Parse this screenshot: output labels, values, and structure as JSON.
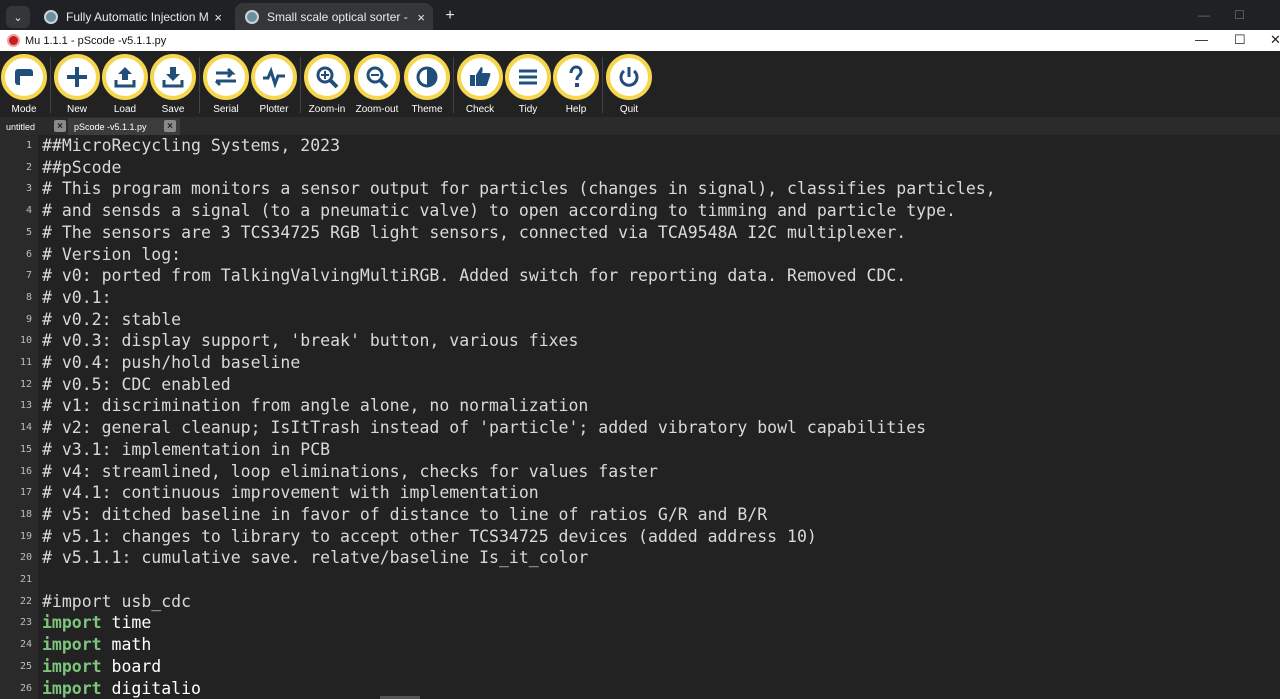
{
  "browser": {
    "tabs": [
      {
        "title": "Fully Automatic Injection Machi",
        "active": false
      },
      {
        "title": "Small scale optical sorter - Rese",
        "active": true
      }
    ],
    "new_tab": "+",
    "close": "×",
    "menu": "⌄"
  },
  "window": {
    "title": "Mu 1.1.1 - pScode -v5.1.1.py",
    "minimize": "—",
    "maximize": "☐",
    "close": "✕"
  },
  "toolbar": {
    "accent": "#f5d64d",
    "buttons": [
      {
        "label": "Mode",
        "icon": "mode-icon"
      },
      {
        "label": "New",
        "icon": "plus-icon"
      },
      {
        "label": "Load",
        "icon": "upload-icon"
      },
      {
        "label": "Save",
        "icon": "download-icon"
      },
      {
        "label": "Serial",
        "icon": "arrows-icon"
      },
      {
        "label": "Plotter",
        "icon": "pulse-icon"
      },
      {
        "label": "Zoom-in",
        "icon": "zoom-in-icon"
      },
      {
        "label": "Zoom-out",
        "icon": "zoom-out-icon"
      },
      {
        "label": "Theme",
        "icon": "contrast-icon"
      },
      {
        "label": "Check",
        "icon": "thumbs-up-icon"
      },
      {
        "label": "Tidy",
        "icon": "lines-icon"
      },
      {
        "label": "Help",
        "icon": "question-icon"
      },
      {
        "label": "Quit",
        "icon": "power-icon"
      }
    ]
  },
  "editor_tabs": [
    {
      "label": "untitled",
      "active": false
    },
    {
      "label": "pScode -v5.1.1.py",
      "active": true
    }
  ],
  "code": {
    "lines": [
      {
        "n": "1",
        "text": "##MicroRecycling Systems, 2023"
      },
      {
        "n": "2",
        "text": "##pScode"
      },
      {
        "n": "3",
        "text": "# This program monitors a sensor output for particles (changes in signal), classifies particles,"
      },
      {
        "n": "4",
        "text": "# and sensds a signal (to a pneumatic valve) to open according to timming and particle type."
      },
      {
        "n": "5",
        "text": "# The sensors are 3 TCS34725 RGB light sensors, connected via TCA9548A I2C multiplexer."
      },
      {
        "n": "6",
        "text": "# Version log:"
      },
      {
        "n": "7",
        "text": "# v0: ported from TalkingValvingMultiRGB. Added switch for reporting data. Removed CDC."
      },
      {
        "n": "8",
        "text": "# v0.1:"
      },
      {
        "n": "9",
        "text": "# v0.2: stable"
      },
      {
        "n": "10",
        "text": "# v0.3: display support, 'break' button, various fixes"
      },
      {
        "n": "11",
        "text": "# v0.4: push/hold baseline"
      },
      {
        "n": "12",
        "text": "# v0.5: CDC enabled"
      },
      {
        "n": "13",
        "text": "# v1: discrimination from angle alone, no normalization"
      },
      {
        "n": "14",
        "text": "# v2: general cleanup; IsItTrash instead of 'particle'; added vibratory bowl capabilities"
      },
      {
        "n": "15",
        "text": "# v3.1: implementation in PCB"
      },
      {
        "n": "16",
        "text": "# v4: streamlined, loop eliminations, checks for values faster"
      },
      {
        "n": "17",
        "text": "# v4.1: continuous improvement with implementation"
      },
      {
        "n": "18",
        "text": "# v5: ditched baseline in favor of distance to line of ratios G/R and B/R"
      },
      {
        "n": "19",
        "text": "# v5.1: changes to library to accept other TCS34725 devices (added address 10)"
      },
      {
        "n": "20",
        "text": "# v5.1.1: cumulative save. relatve/baseline Is_it_color"
      },
      {
        "n": "21",
        "text": ""
      },
      {
        "n": "22",
        "text": "#import usb_cdc"
      }
    ],
    "imports": [
      {
        "n": "23",
        "kw": "import",
        "mod": " time"
      },
      {
        "n": "24",
        "kw": "import",
        "mod": " math"
      },
      {
        "n": "25",
        "kw": "import",
        "mod": " board"
      },
      {
        "n": "26",
        "kw": "import",
        "mod": " digitalio"
      }
    ]
  }
}
